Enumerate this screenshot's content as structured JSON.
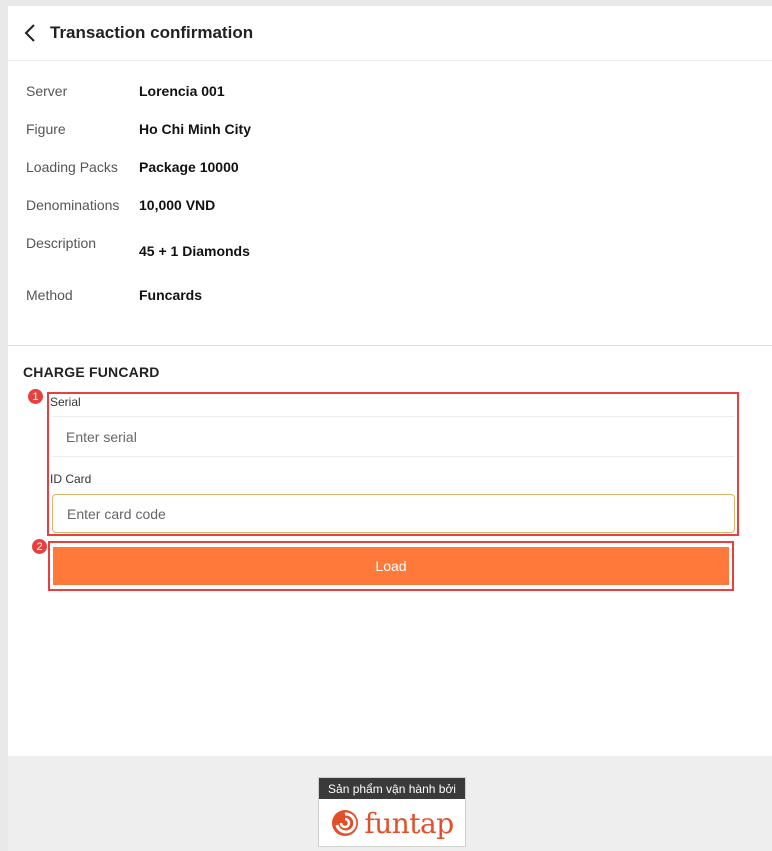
{
  "header": {
    "title": "Transaction confirmation",
    "back_icon": "chevron-left-icon"
  },
  "details": [
    {
      "label": "Server",
      "value": "Lorencia 001"
    },
    {
      "label": "Figure",
      "value": "Ho Chi Minh City"
    },
    {
      "label": "Loading Packs",
      "value": "Package 10000"
    },
    {
      "label": "Denominations",
      "value": "10,000 VND"
    },
    {
      "label": "Description",
      "value": "45 + 1 Diamonds"
    },
    {
      "label": "Method",
      "value": "Funcards"
    }
  ],
  "charge": {
    "title": "CHARGE FUNCARD",
    "serial_label": "Serial",
    "serial_placeholder": "Enter serial",
    "serial_value": "",
    "card_label": "ID Card",
    "card_placeholder": "Enter card code",
    "card_value": "",
    "load_label": "Load"
  },
  "annotations": {
    "badge_1": "1",
    "badge_2": "2",
    "color": "#e8403f"
  },
  "footer": {
    "caption": "Sản phẩm vận hành bởi",
    "brand": "funtap",
    "brand_icon": "funtap-swirl-logo-icon",
    "brand_color": "#e2502a"
  },
  "colors": {
    "accent_button": "#ff7a3a",
    "input_focus_border": "#d9b46a"
  }
}
